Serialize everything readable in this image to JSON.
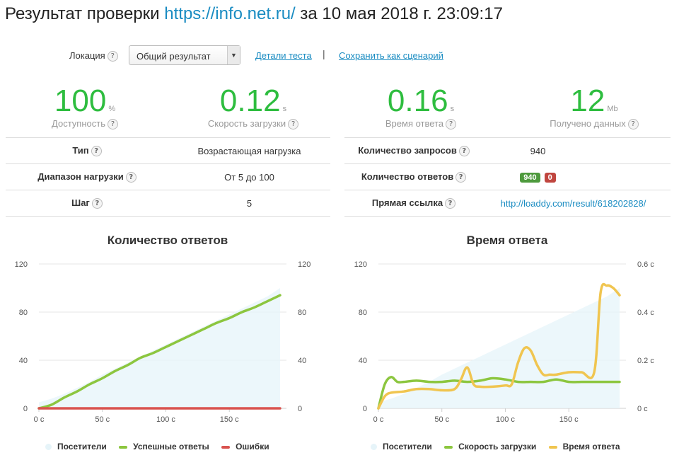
{
  "header": {
    "title_prefix": "Результат проверки",
    "title_url": "https://info.net.ru/",
    "title_suffix": "за 10 мая 2018 г. 23:09:17"
  },
  "controls": {
    "location_label": "Локация",
    "location_value": "Общий результат",
    "details_link": "Детали теста",
    "separator": "|",
    "save_link": "Сохранить как сценарий"
  },
  "metrics": [
    {
      "value": "100",
      "unit": "%",
      "label": "Доступность"
    },
    {
      "value": "0.12",
      "unit": "s",
      "label": "Скорость загрузки"
    },
    {
      "value": "0.16",
      "unit": "s",
      "label": "Время ответа"
    },
    {
      "value": "12",
      "unit": "Mb",
      "label": "Получено данных"
    }
  ],
  "left_table": [
    {
      "key": "Тип",
      "value": "Возрастающая нагрузка"
    },
    {
      "key": "Диапазон нагрузки",
      "value": "От 5 до 100"
    },
    {
      "key": "Шаг",
      "value": "5"
    }
  ],
  "right_table": {
    "requests_label": "Количество запросов",
    "requests_value": "940",
    "responses_label": "Количество ответов",
    "responses_ok": "940",
    "responses_err": "0",
    "link_label": "Прямая ссылка",
    "link_value": "http://loaddy.com/result/618202828/"
  },
  "help_glyph": "?",
  "colors": {
    "accent": "#2ebd3f",
    "link": "#1a8cc2",
    "visitors": "#e6f4f9",
    "success": "#8cc63f",
    "errors": "#d9534f",
    "response": "#f0c550"
  },
  "chart_data": [
    {
      "type": "line",
      "title": "Количество ответов",
      "x_ticks": [
        "0 c",
        "50 c",
        "100 c",
        "150 c"
      ],
      "x_tick_values": [
        0,
        50,
        100,
        150
      ],
      "y_ticks": [
        "0",
        "40",
        "80",
        "120"
      ],
      "y_tick_values": [
        0,
        40,
        80,
        120
      ],
      "y2_ticks": [
        "0",
        "40",
        "80",
        "120"
      ],
      "y2_tick_values": [
        0,
        40,
        80,
        120
      ],
      "xlim": [
        0,
        195
      ],
      "ylim": [
        0,
        120
      ],
      "y2lim": [
        0,
        120
      ],
      "legend": [
        "Посетители",
        "Успешные ответы",
        "Ошибки"
      ],
      "legend_position": "bottom",
      "series": [
        {
          "name": "Посетители",
          "type": "area",
          "axis": "left",
          "x": [
            0,
            10,
            20,
            30,
            40,
            50,
            60,
            70,
            80,
            90,
            100,
            110,
            120,
            130,
            140,
            150,
            160,
            170,
            180,
            190
          ],
          "values": [
            5,
            8,
            12,
            17,
            22,
            28,
            33,
            38,
            43,
            48,
            53,
            58,
            63,
            68,
            73,
            78,
            83,
            88,
            93,
            100
          ]
        },
        {
          "name": "Успешные ответы",
          "type": "line",
          "axis": "left",
          "x": [
            0,
            10,
            20,
            30,
            40,
            50,
            60,
            70,
            80,
            90,
            100,
            110,
            120,
            130,
            140,
            150,
            160,
            170,
            180,
            190
          ],
          "values": [
            0,
            3,
            9,
            14,
            20,
            25,
            31,
            36,
            42,
            46,
            51,
            56,
            61,
            66,
            71,
            75,
            80,
            84,
            89,
            94
          ]
        },
        {
          "name": "Ошибки",
          "type": "line",
          "axis": "left",
          "x": [
            0,
            190
          ],
          "values": [
            0,
            0
          ]
        }
      ]
    },
    {
      "type": "line",
      "title": "Время ответа",
      "x_ticks": [
        "0 c",
        "50 c",
        "100 c",
        "150 c"
      ],
      "x_tick_values": [
        0,
        50,
        100,
        150
      ],
      "y_ticks": [
        "0",
        "40",
        "80",
        "120"
      ],
      "y_tick_values": [
        0,
        40,
        80,
        120
      ],
      "y2_ticks": [
        "0 c",
        "0.2 c",
        "0.4 c",
        "0.6 c"
      ],
      "y2_tick_values": [
        0,
        0.2,
        0.4,
        0.6
      ],
      "xlim": [
        0,
        195
      ],
      "ylim": [
        0,
        120
      ],
      "y2lim": [
        0,
        0.6
      ],
      "legend": [
        "Посетители",
        "Скорость загрузки",
        "Время ответа"
      ],
      "legend_position": "bottom",
      "series": [
        {
          "name": "Посетители",
          "type": "area",
          "axis": "left",
          "x": [
            0,
            10,
            20,
            30,
            40,
            50,
            60,
            70,
            80,
            90,
            100,
            110,
            120,
            130,
            140,
            150,
            160,
            170,
            180,
            190
          ],
          "values": [
            5,
            8,
            12,
            17,
            22,
            28,
            33,
            38,
            43,
            48,
            53,
            58,
            63,
            68,
            73,
            78,
            83,
            88,
            93,
            100
          ]
        },
        {
          "name": "Скорость загрузки",
          "type": "line",
          "axis": "right",
          "x": [
            0,
            5,
            10,
            15,
            20,
            30,
            40,
            50,
            60,
            70,
            80,
            90,
            100,
            110,
            120,
            130,
            140,
            150,
            160,
            170,
            180,
            190
          ],
          "values": [
            0.0,
            0.1,
            0.13,
            0.11,
            0.11,
            0.115,
            0.11,
            0.11,
            0.115,
            0.11,
            0.115,
            0.125,
            0.12,
            0.11,
            0.11,
            0.11,
            0.12,
            0.11,
            0.11,
            0.11,
            0.11,
            0.11
          ]
        },
        {
          "name": "Время ответа",
          "type": "line",
          "axis": "right",
          "x": [
            0,
            5,
            10,
            20,
            30,
            40,
            50,
            60,
            65,
            70,
            75,
            80,
            90,
            100,
            105,
            110,
            115,
            120,
            125,
            130,
            135,
            140,
            150,
            160,
            170,
            175,
            180,
            185,
            190
          ],
          "values": [
            0.0,
            0.05,
            0.065,
            0.07,
            0.08,
            0.08,
            0.075,
            0.08,
            0.12,
            0.17,
            0.1,
            0.09,
            0.09,
            0.095,
            0.1,
            0.19,
            0.25,
            0.24,
            0.18,
            0.14,
            0.14,
            0.14,
            0.15,
            0.15,
            0.15,
            0.48,
            0.51,
            0.5,
            0.47
          ]
        }
      ]
    }
  ]
}
